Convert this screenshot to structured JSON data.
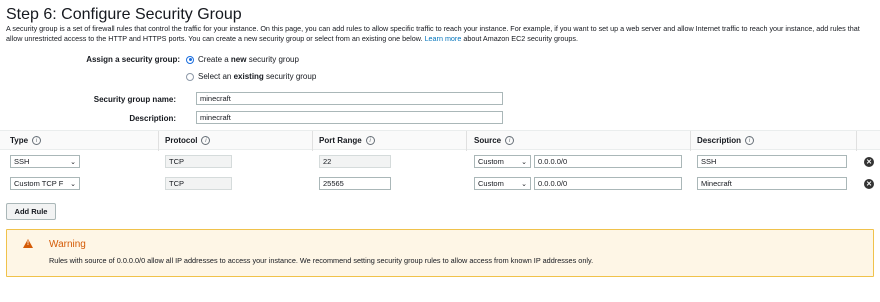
{
  "header": {
    "title": "Step 6: Configure Security Group",
    "intro_text": "A security group is a set of firewall rules that control the traffic for your instance. On this page, you can add rules to allow specific traffic to reach your instance. For example, if you want to set up a web server and allow Internet traffic to reach your instance, add rules that allow unrestricted access to the HTTP and HTTPS ports. You can create a new security group or select from an existing one below.",
    "learn_more": "Learn more",
    "intro_tail": "about Amazon EC2 security groups."
  },
  "assign": {
    "label": "Assign a security group:",
    "option_new_pre": "Create a ",
    "option_new_bold": "new",
    "option_new_post": " security group",
    "option_existing_pre": "Select an ",
    "option_existing_bold": "existing",
    "option_existing_post": " security group",
    "selected": "new"
  },
  "form": {
    "name_label": "Security group name:",
    "name_value": "minecraft",
    "description_label": "Description:",
    "description_value": "minecraft"
  },
  "table": {
    "headers": {
      "type": "Type",
      "protocol": "Protocol",
      "port_range": "Port Range",
      "source": "Source",
      "description": "Description"
    },
    "info_glyph": "i",
    "rows": [
      {
        "type": "SSH",
        "protocol": "TCP",
        "port_range": "22",
        "source_mode": "Custom",
        "source_cidr": "0.0.0.0/0",
        "description": "SSH"
      },
      {
        "type": "Custom TCP F",
        "protocol": "TCP",
        "port_range": "25565",
        "source_mode": "Custom",
        "source_cidr": "0.0.0.0/0",
        "description": "Minecraft"
      }
    ]
  },
  "add_rule_label": "Add Rule",
  "warning": {
    "title": "Warning",
    "text": "Rules with source of 0.0.0.0/0 allow all IP addresses to access your instance. We recommend setting security group rules to allow access from known IP addresses only."
  },
  "colors": {
    "link": "#0073bb",
    "warning_accent": "#d45b07",
    "warning_bg": "#fef6e6"
  }
}
